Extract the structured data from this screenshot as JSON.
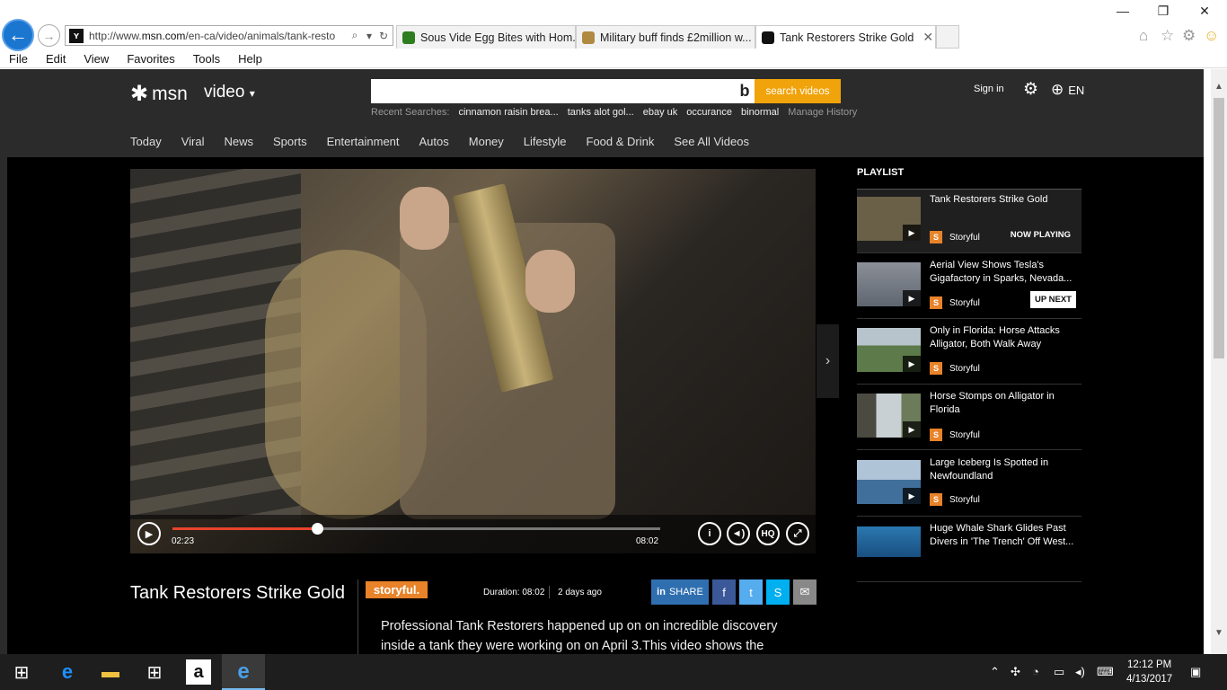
{
  "browser": {
    "url_prefix": "http://www.",
    "url_host": "msn.com",
    "url_rest": "/en-ca/video/animals/tank-resto",
    "tabs": [
      {
        "label": "Sous Vide Egg Bites with Hom...",
        "color": "#2e7d1e"
      },
      {
        "label": "Military buff finds £2million w...",
        "color": "#b08a40"
      },
      {
        "label": "Tank Restorers Strike Gold",
        "color": "#111111"
      }
    ],
    "menu": [
      "File",
      "Edit",
      "View",
      "Favorites",
      "Tools",
      "Help"
    ]
  },
  "header": {
    "logo": "msn",
    "section": "video",
    "search_placeholder": "",
    "search_button": "search videos",
    "recent_label": "Recent Searches:",
    "recent_terms": [
      "cinnamon raisin brea...",
      "tanks alot gol...",
      "ebay uk",
      "occurance",
      "binormal"
    ],
    "manage_history": "Manage History",
    "sign_in": "Sign in",
    "language": "EN"
  },
  "nav": [
    "Today",
    "Viral",
    "News",
    "Sports",
    "Entertainment",
    "Autos",
    "Money",
    "Lifestyle",
    "Food & Drink",
    "See All Videos"
  ],
  "player": {
    "current_time": "02:23",
    "duration_time": "08:02",
    "progress": 0.297,
    "hq_label": "HQ",
    "info_label": "i"
  },
  "video": {
    "title": "Tank Restorers Strike Gold",
    "brand": "storyful.",
    "duration_label": "Duration: 08:02",
    "age": "2 days ago",
    "share_label": "SHARE",
    "description": "Professional Tank Restorers happened up on on incredible discovery inside a tank they were working on on April 3.This video shows the"
  },
  "playlist": {
    "heading": "PLAYLIST",
    "items": [
      {
        "title": "Tank Restorers Strike Gold",
        "source": "Storyful",
        "badge": "NOW PLAYING",
        "thumb": "#6a6048"
      },
      {
        "title": "Aerial View Shows Tesla's Gigafactory in Sparks, Nevada...",
        "source": "Storyful",
        "badge": "UP NEXT",
        "thumb": "#8a8f98"
      },
      {
        "title": "Only in Florida: Horse Attacks Alligator, Both Walk Away",
        "source": "Storyful",
        "badge": "",
        "thumb": "#5c7a4a"
      },
      {
        "title": "Horse Stomps on Alligator in Florida",
        "source": "Storyful",
        "badge": "",
        "thumb": "#6c7c5a"
      },
      {
        "title": "Large Iceberg Is Spotted in Newfoundland",
        "source": "Storyful",
        "badge": "",
        "thumb": "#3f6f9a"
      },
      {
        "title": "Huge Whale Shark Glides Past Divers in 'The Trench' Off West...",
        "source": "",
        "badge": "",
        "thumb": "#2a78b0"
      }
    ]
  },
  "taskbar": {
    "time": "12:12 PM",
    "date": "4/13/2017"
  }
}
